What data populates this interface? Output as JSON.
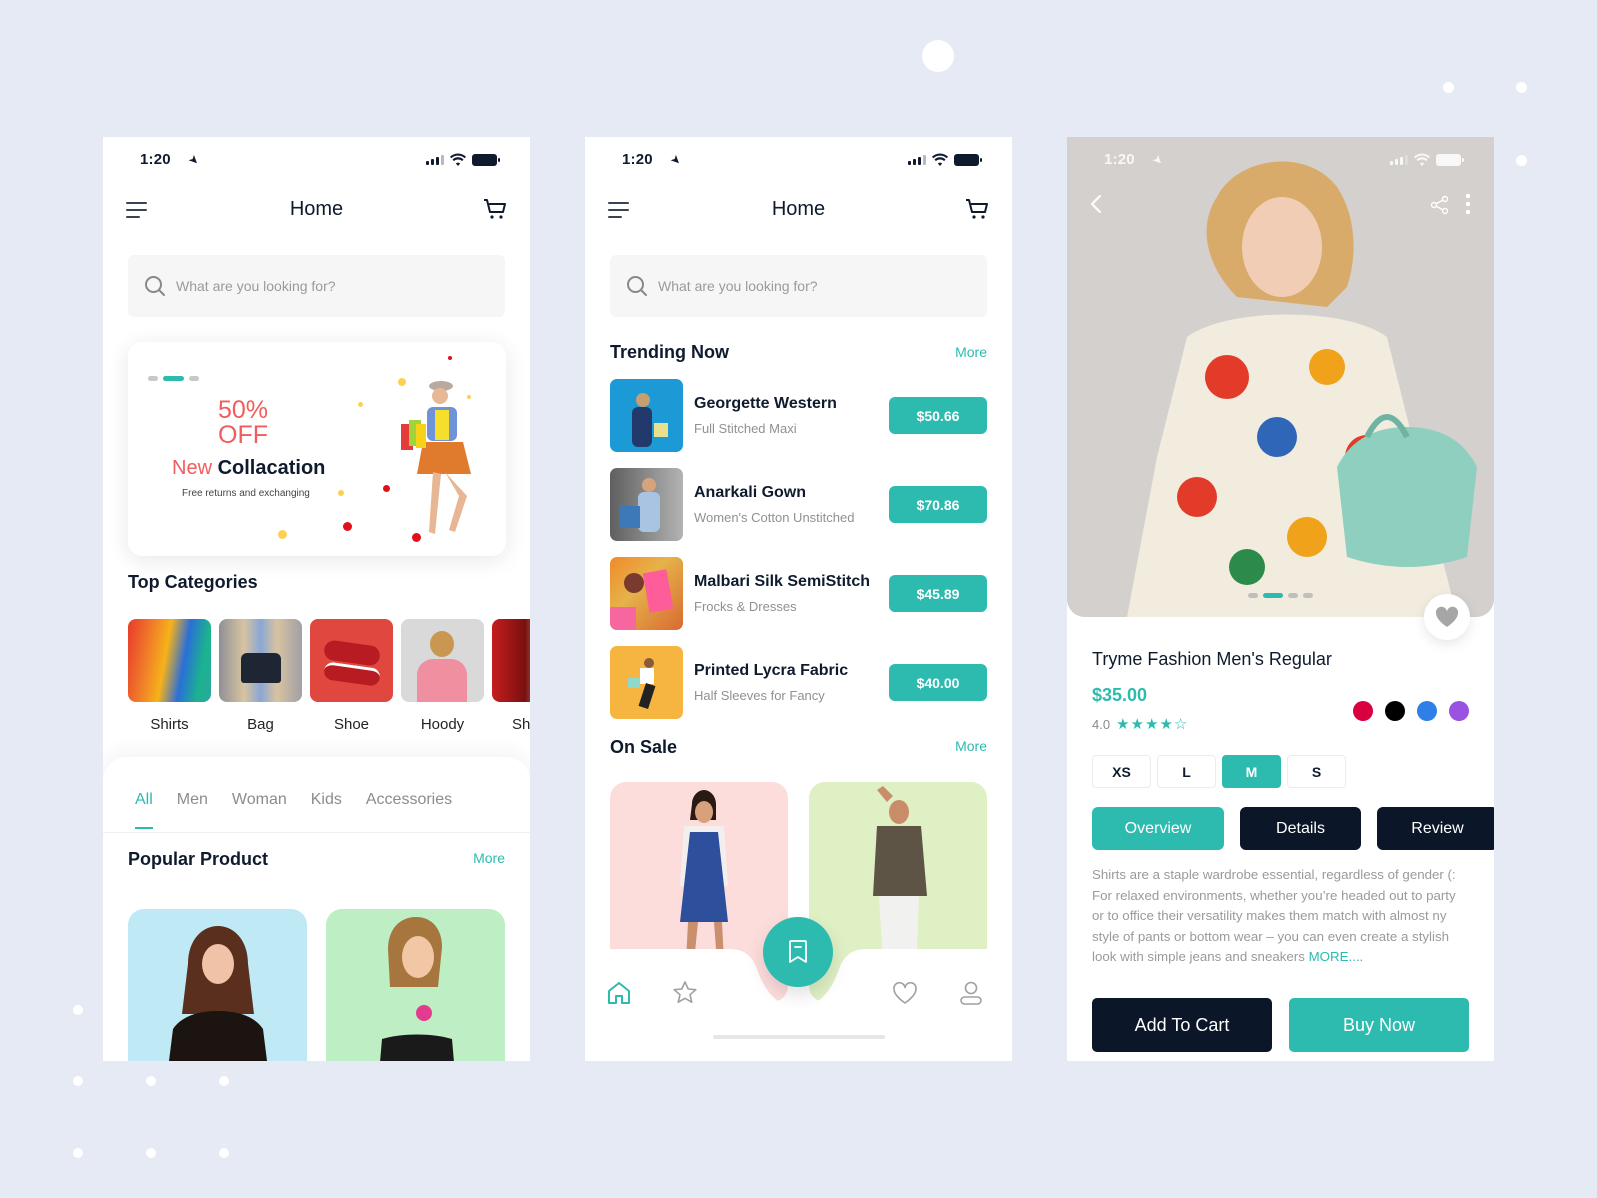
{
  "theme": {
    "accent": "#2dbbaf",
    "dark": "#0b1628",
    "sale_red": "#f25c5c",
    "background": "#e6eaf4"
  },
  "status_bar": {
    "time": "1:20",
    "location_icon": "location-arrow-icon",
    "signal_icon": "cellular-signal-icon",
    "wifi_icon": "wifi-icon",
    "battery_icon": "battery-icon"
  },
  "home_screen": {
    "title": "Home",
    "menu_icon": "hamburger-menu-icon",
    "cart_icon": "shopping-cart-icon",
    "search": {
      "placeholder": "What are you looking for?",
      "value": ""
    }
  },
  "phone1": {
    "banner": {
      "discount_line1": "50%",
      "discount_line2": "OFF",
      "headline_highlight": "New",
      "headline_rest": "Collacation",
      "subtext": "Free returns and exchanging",
      "pager_active_index": 1,
      "pager_count": 3
    },
    "top_categories": {
      "title": "Top Categories",
      "items": [
        {
          "label": "Shirts"
        },
        {
          "label": "Bag"
        },
        {
          "label": "Shoe"
        },
        {
          "label": "Hoody"
        },
        {
          "label": "Sh"
        }
      ]
    },
    "filter_tabs": [
      {
        "label": "All",
        "active": true
      },
      {
        "label": "Men",
        "active": false
      },
      {
        "label": "Woman",
        "active": false
      },
      {
        "label": "Kids",
        "active": false
      },
      {
        "label": "Accessories",
        "active": false
      }
    ],
    "popular": {
      "title": "Popular Product",
      "more_label": "More"
    }
  },
  "phone2": {
    "trending": {
      "title": "Trending Now",
      "more_label": "More",
      "items": [
        {
          "name": "Georgette Western",
          "desc": "Full Stitched Maxi",
          "price": "$50.66"
        },
        {
          "name": "Anarkali Gown",
          "desc": "Women's Cotton Unstitched",
          "price": "$70.86"
        },
        {
          "name": "Malbari Silk SemiStitch",
          "desc": "Frocks & Dresses",
          "price": "$45.89"
        },
        {
          "name": "Printed Lycra Fabric",
          "desc": "Half Sleeves for Fancy",
          "price": "$40.00"
        }
      ]
    },
    "on_sale": {
      "title": "On Sale",
      "more_label": "More"
    },
    "tab_bar": {
      "items": [
        {
          "icon": "home-icon",
          "active": true
        },
        {
          "icon": "star-icon",
          "active": false
        },
        {
          "icon": "bookmark-icon",
          "active": false,
          "fab": true
        },
        {
          "icon": "heart-icon",
          "active": false
        },
        {
          "icon": "user-icon",
          "active": false
        }
      ]
    }
  },
  "phone3": {
    "back_icon": "chevron-left-icon",
    "share_icon": "share-icon",
    "more_icon": "more-vertical-icon",
    "favorite_icon": "heart-icon",
    "image_pager_active_index": 1,
    "image_pager_count": 4,
    "product": {
      "title": "Tryme Fashion Men's Regular",
      "price": "$35.00",
      "rating": "4.0",
      "rating_value": 4,
      "rating_max": 5,
      "colors": [
        "#d8003f",
        "#000000",
        "#2f7fe8",
        "#9a52e0"
      ],
      "sizes": [
        {
          "label": "XS",
          "selected": false
        },
        {
          "label": "L",
          "selected": false
        },
        {
          "label": "M",
          "selected": true
        },
        {
          "label": "S",
          "selected": false
        }
      ]
    },
    "info_tabs": [
      {
        "label": "Overview",
        "active": true
      },
      {
        "label": "Details",
        "active": false
      },
      {
        "label": "Review",
        "active": false
      }
    ],
    "description_lines": [
      "Shirts are a staple wardrobe essential, regardless of gender (:",
      "For relaxed environments, whether you’re headed out to party",
      "or to office their versatility makes them match with almost ny",
      "style of pants or bottom wear – you can even create a stylish",
      "look with simple jeans and sneakers"
    ],
    "more_label": "MORE....",
    "add_to_cart_label": "Add To Cart",
    "buy_now_label": "Buy Now"
  }
}
